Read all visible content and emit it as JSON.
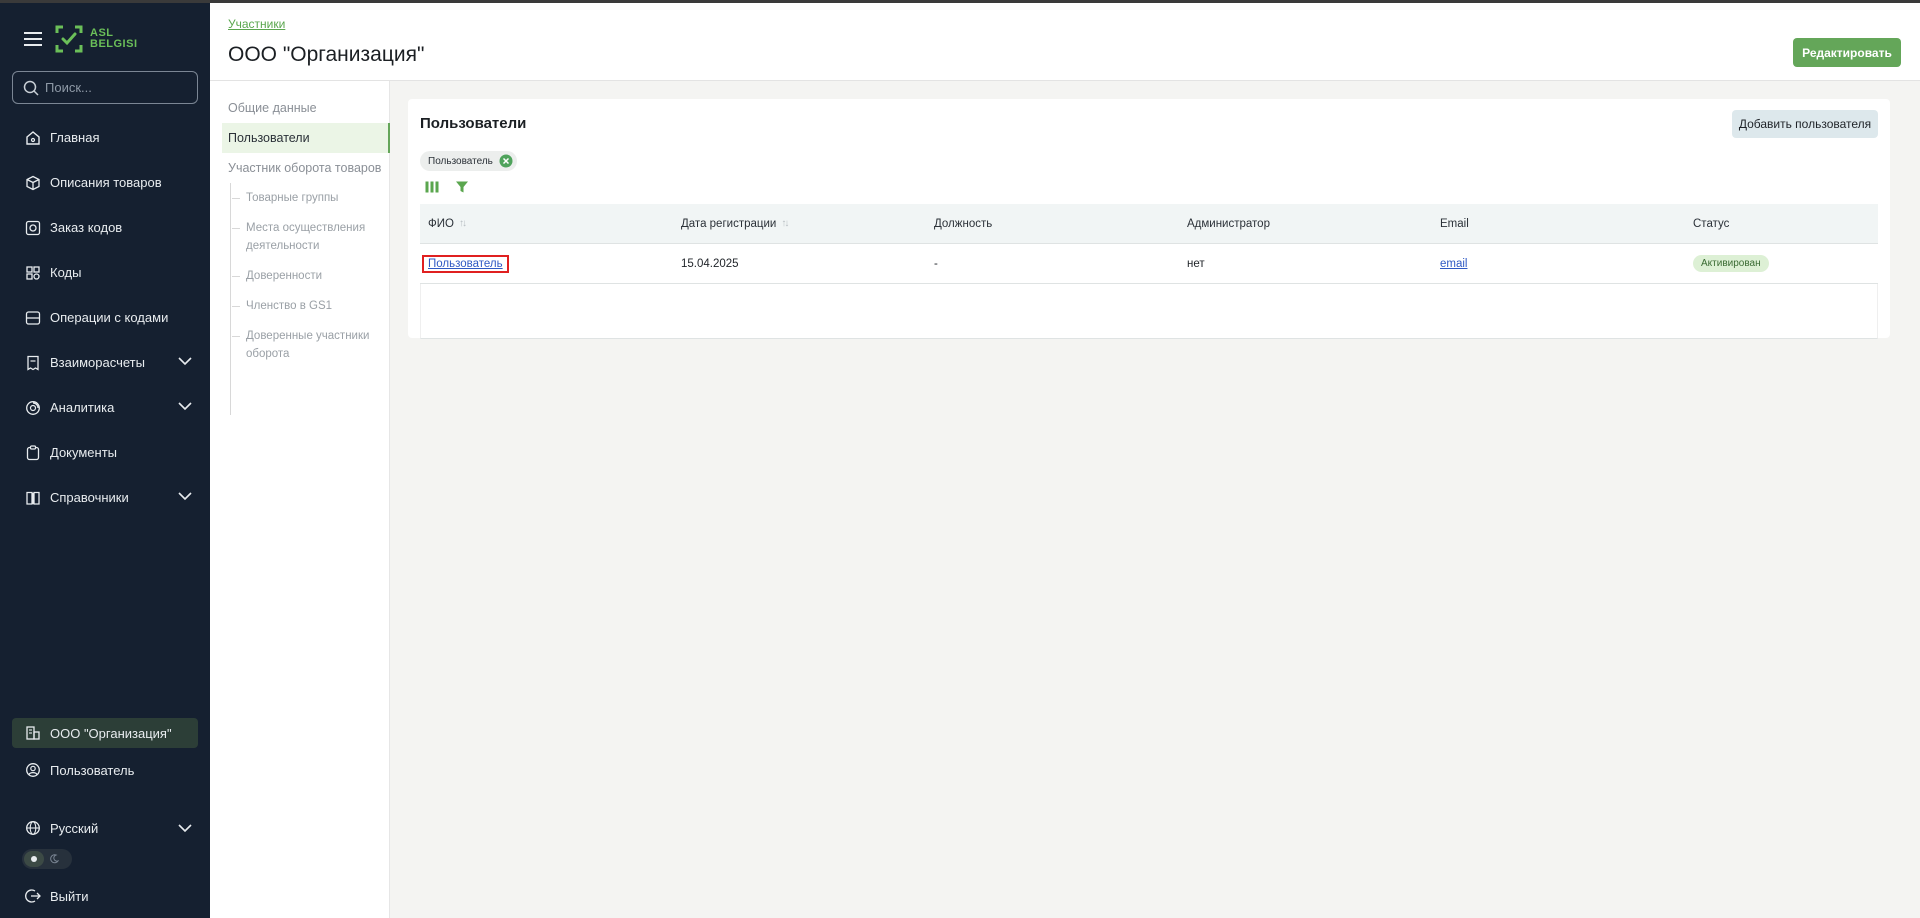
{
  "brand": {
    "line1": "ASL",
    "line2": "BELGISI",
    "color": "#6bbf59"
  },
  "search": {
    "placeholder": "Поиск..."
  },
  "nav": {
    "items": [
      {
        "label": "Главная",
        "icon": "home-icon"
      },
      {
        "label": "Описания товаров",
        "icon": "box-icon"
      },
      {
        "label": "Заказ кодов",
        "icon": "code-order-icon"
      },
      {
        "label": "Коды",
        "icon": "codes-icon"
      },
      {
        "label": "Операции с кодами",
        "icon": "operations-icon"
      },
      {
        "label": "Взаиморасчеты",
        "icon": "receipt-icon",
        "expandable": true
      },
      {
        "label": "Аналитика",
        "icon": "analytics-icon",
        "expandable": true
      },
      {
        "label": "Документы",
        "icon": "clipboard-icon"
      },
      {
        "label": "Справочники",
        "icon": "book-icon",
        "expandable": true
      }
    ]
  },
  "sidebar_bottom": {
    "org": "ООО \"Организация\"",
    "user": "Пользователь",
    "language": "Русский",
    "logout": "Выйти"
  },
  "header": {
    "breadcrumb": "Участники",
    "title": "ООО \"Организация\"",
    "edit_label": "Редактировать"
  },
  "subnav": {
    "general": "Общие данные",
    "users": "Пользователи",
    "participant": "Участник оборота товаров",
    "children": [
      "Товарные группы",
      "Места осуществления деятельности",
      "Доверенности",
      "Членство в GS1",
      "Доверенные участники оборота"
    ]
  },
  "card": {
    "title": "Пользователи",
    "add_label": "Добавить пользователя",
    "chip": "Пользователь"
  },
  "table": {
    "columns": [
      "ФИО",
      "Дата регистрации",
      "Должность",
      "Администратор",
      "Email",
      "Статус"
    ],
    "rows": [
      {
        "name": "Пользователь",
        "date": "15.04.2025",
        "position": "-",
        "admin": "нет",
        "email": "email",
        "status": "Активирован"
      }
    ]
  },
  "colors": {
    "accent": "#64a659",
    "sidebar_bg": "#152030",
    "highlight": "#e02020"
  }
}
